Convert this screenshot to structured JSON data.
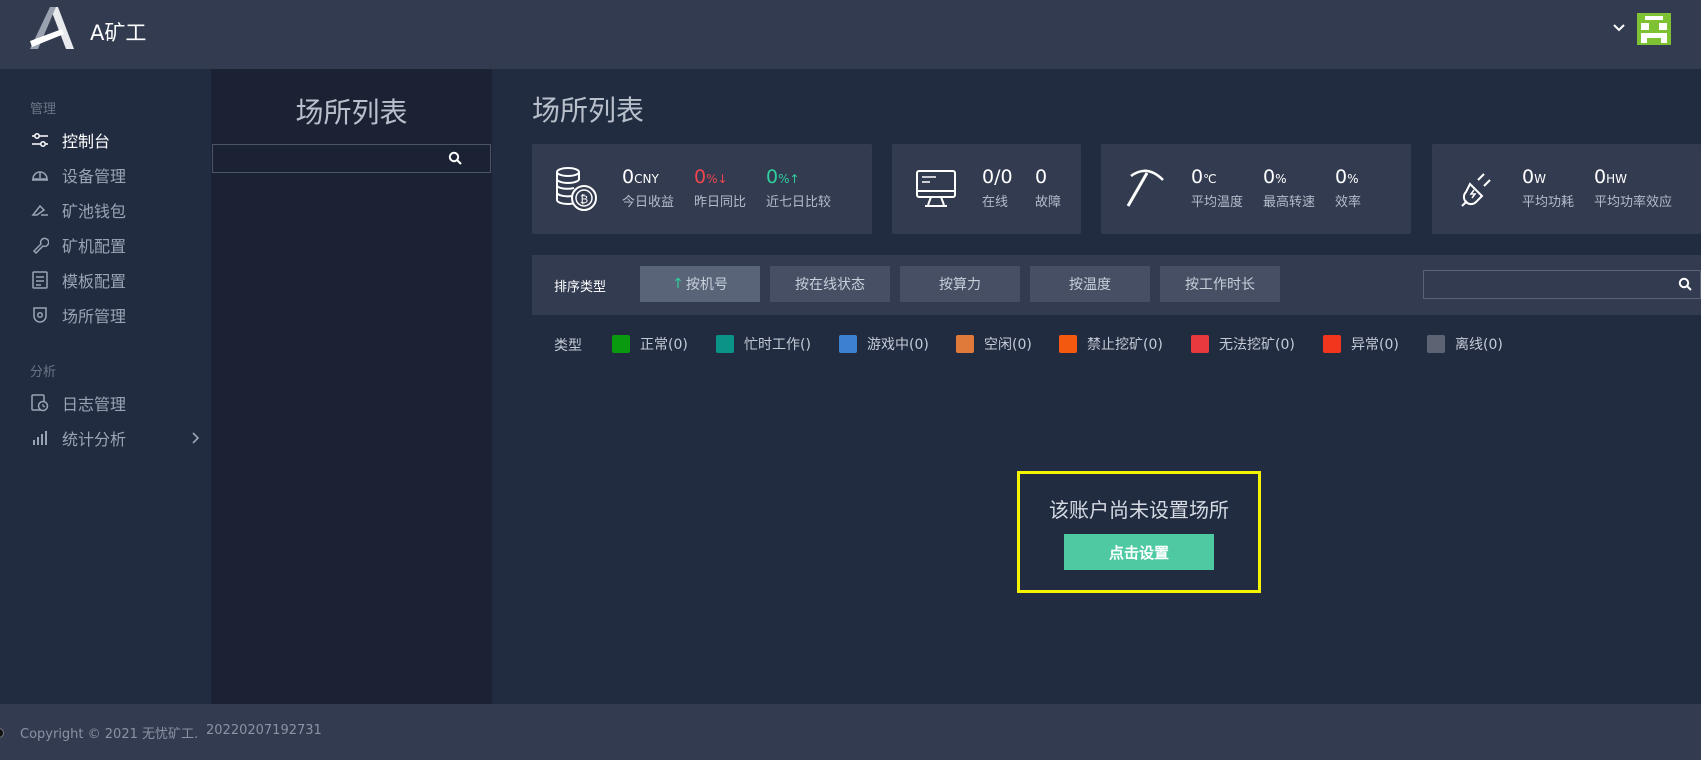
{
  "app": {
    "logo_text": "A矿工",
    "avatar_color": "#7ec234"
  },
  "sidebar": {
    "group_manage": "管理",
    "group_analysis": "分析",
    "items": [
      {
        "label": "控制台",
        "icon": "sliders-icon",
        "active": true
      },
      {
        "label": "设备管理",
        "icon": "helmet-icon"
      },
      {
        "label": "矿池钱包",
        "icon": "wallet-icon"
      },
      {
        "label": "矿机配置",
        "icon": "wrench-icon"
      },
      {
        "label": "模板配置",
        "icon": "template-icon"
      },
      {
        "label": "场所管理",
        "icon": "location-icon"
      },
      {
        "label": "日志管理",
        "icon": "log-clock-icon"
      },
      {
        "label": "统计分析",
        "icon": "bar-chart-icon"
      }
    ]
  },
  "site_list": {
    "title": "场所列表",
    "search_placeholder": ""
  },
  "main": {
    "title": "场所列表",
    "cards": {
      "income": {
        "value": "0",
        "unit": "CNY",
        "label": "今日收益"
      },
      "yesterday": {
        "value": "0",
        "unit": "%",
        "arrow": "↓",
        "label": "昨日同比"
      },
      "week": {
        "value": "0",
        "unit": "%",
        "arrow": "↑",
        "label": "近七日比较"
      },
      "online": {
        "value": "0/0",
        "label": "在线"
      },
      "fault": {
        "value": "0",
        "label": "故障"
      },
      "temp": {
        "value": "0",
        "unit": "℃",
        "label": "平均温度"
      },
      "speed": {
        "value": "0",
        "unit": "%",
        "label": "最高转速"
      },
      "eff": {
        "value": "0",
        "unit": "%",
        "label": "效率"
      },
      "power": {
        "value": "0",
        "unit": "W",
        "label": "平均功耗"
      },
      "power_eff": {
        "value": "0",
        "unit": "HW",
        "label": "平均功率效应"
      }
    },
    "sort": {
      "label": "排序类型",
      "buttons": [
        "按机号",
        "按在线状态",
        "按算力",
        "按温度",
        "按工作时长"
      ],
      "active_arrow": "↑",
      "search_placeholder": ""
    },
    "legend": {
      "label": "类型",
      "items": [
        {
          "label": "正常(0)",
          "color": "#0a9a10"
        },
        {
          "label": "忙时工作()",
          "color": "#0a9488"
        },
        {
          "label": "游戏中(0)",
          "color": "#3d7fd0"
        },
        {
          "label": "空闲(0)",
          "color": "#e07a3a"
        },
        {
          "label": "禁止挖矿(0)",
          "color": "#f45a0f"
        },
        {
          "label": "无法挖矿(0)",
          "color": "#e83a3e"
        },
        {
          "label": "异常(0)",
          "color": "#f2361e"
        },
        {
          "label": "离线(0)",
          "color": "#5c6373"
        }
      ]
    },
    "empty": {
      "message": "该账户尚未设置场所",
      "button": "点击设置"
    }
  },
  "footer": {
    "copyright": "Copyright © 2021 无忧矿工.",
    "version": "20220207192731"
  }
}
